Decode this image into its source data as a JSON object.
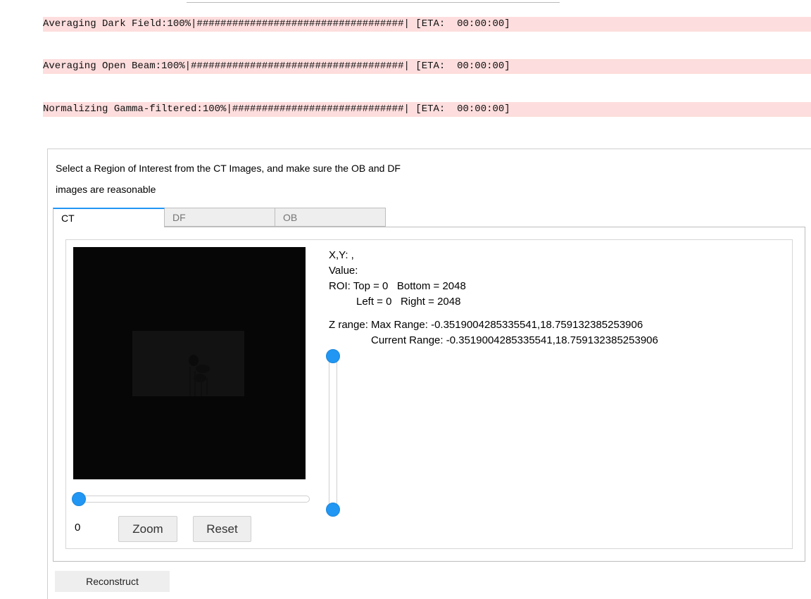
{
  "output": {
    "lines": [
      "Averaging Dark Field:100%|###################################| [ETA:  00:00:00]",
      "Averaging Open Beam:100%|####################################| [ETA:  00:00:00]",
      "Normalizing Gamma-filtered:100%|#############################| [ETA:  00:00:00]"
    ]
  },
  "widget": {
    "instruction_line1": "Select a Region of Interest from the CT Images, and make sure the OB and DF",
    "instruction_line2": "images are reasonable",
    "tabs": [
      {
        "label": "CT",
        "active": true
      },
      {
        "label": "DF",
        "active": false
      },
      {
        "label": "OB",
        "active": false
      }
    ],
    "slice_slider": {
      "value": "0",
      "position_fraction": 0
    },
    "buttons": {
      "zoom": "Zoom",
      "reset": "Reset",
      "reconstruct": "Reconstruct"
    },
    "info": {
      "xy": "X,Y: ,",
      "value": "Value:",
      "roi_line1": "ROI: Top = 0   Bottom = 2048",
      "roi_line2": "Left = 0   Right = 2048",
      "zrange_line1": "Z range: Max Range: -0.3519004285335541,18.759132385253906",
      "zrange_line2": "Current Range: -0.3519004285335541,18.759132385253906"
    },
    "range_slider": {
      "low_fraction": 0,
      "high_fraction": 1
    },
    "colors": {
      "accent": "#2196f3",
      "output_bg": "#fddddd"
    }
  }
}
